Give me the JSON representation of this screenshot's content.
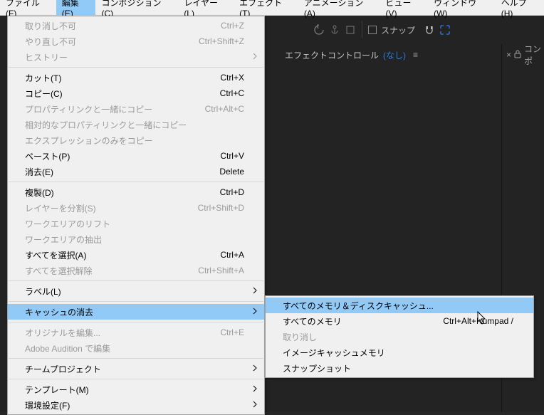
{
  "menubar": {
    "items": [
      "ファイル(F)",
      "編集(E)",
      "コンポジション(C)",
      "レイヤー(L)",
      "エフェクト(T)",
      "アニメーション(A)",
      "ビュー(V)",
      "ウィンドウ(W)",
      "ヘルプ(H)"
    ],
    "active_index": 1
  },
  "toolbar": {
    "snap_label": "スナップ"
  },
  "panel": {
    "effect_controls_label": "エフェクトコントロール",
    "effect_controls_target": "(なし)",
    "right_tab_label": "コンポ"
  },
  "edit_menu": {
    "groups": [
      [
        {
          "label": "取り消し不可",
          "shortcut": "Ctrl+Z",
          "disabled": true
        },
        {
          "label": "やり直し不可",
          "shortcut": "Ctrl+Shift+Z",
          "disabled": true
        },
        {
          "label": "ヒストリー",
          "submenu": true,
          "disabled": true
        }
      ],
      [
        {
          "label": "カット(T)",
          "shortcut": "Ctrl+X"
        },
        {
          "label": "コピー(C)",
          "shortcut": "Ctrl+C"
        },
        {
          "label": "プロパティリンクと一緒にコピー",
          "shortcut": "Ctrl+Alt+C",
          "disabled": true
        },
        {
          "label": "相対的なプロパティリンクと一緒にコピー",
          "disabled": true
        },
        {
          "label": "エクスプレッションのみをコピー",
          "disabled": true
        },
        {
          "label": "ペースト(P)",
          "shortcut": "Ctrl+V"
        },
        {
          "label": "消去(E)",
          "shortcut": "Delete"
        }
      ],
      [
        {
          "label": "複製(D)",
          "shortcut": "Ctrl+D"
        },
        {
          "label": "レイヤーを分割(S)",
          "shortcut": "Ctrl+Shift+D",
          "disabled": true
        },
        {
          "label": "ワークエリアのリフト",
          "disabled": true
        },
        {
          "label": "ワークエリアの抽出",
          "disabled": true
        },
        {
          "label": "すべてを選択(A)",
          "shortcut": "Ctrl+A"
        },
        {
          "label": "すべてを選択解除",
          "shortcut": "Ctrl+Shift+A",
          "disabled": true
        }
      ],
      [
        {
          "label": "ラベル(L)",
          "submenu": true
        }
      ],
      [
        {
          "label": "キャッシュの消去",
          "submenu": true,
          "hover": true
        }
      ],
      [
        {
          "label": "オリジナルを編集...",
          "shortcut": "Ctrl+E",
          "disabled": true
        },
        {
          "label": "Adobe Audition で編集",
          "disabled": true
        }
      ],
      [
        {
          "label": "チームプロジェクト",
          "submenu": true
        }
      ],
      [
        {
          "label": "テンプレート(M)",
          "submenu": true
        },
        {
          "label": "環境設定(F)",
          "submenu": true
        }
      ]
    ]
  },
  "cache_submenu": {
    "items": [
      {
        "label": "すべてのメモリ＆ディスクキャッシュ...",
        "hover": true
      },
      {
        "label": "すべてのメモリ",
        "shortcut": "Ctrl+Alt+Numpad /"
      },
      {
        "label": "取り消し",
        "disabled": true
      },
      {
        "label": "イメージキャッシュメモリ"
      },
      {
        "label": "スナップショット"
      }
    ]
  }
}
